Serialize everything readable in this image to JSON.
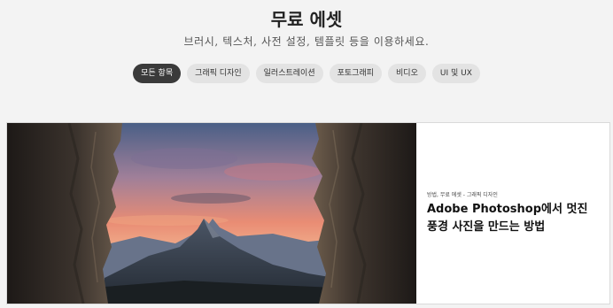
{
  "header": {
    "title": "무료 에셋",
    "subtitle": "브러시, 텍스처, 사전 설정, 템플릿 등을 이용하세요."
  },
  "filters": [
    {
      "label": "모든 항목",
      "active": true
    },
    {
      "label": "그래픽 디자인",
      "active": false
    },
    {
      "label": "일러스트레이션",
      "active": false
    },
    {
      "label": "포토그래피",
      "active": false
    },
    {
      "label": "비디오",
      "active": false
    },
    {
      "label": "UI 및 UX",
      "active": false
    }
  ],
  "featured": {
    "meta": "방법, 무료 에셋 - 그래픽 디자인",
    "headline_line1": "Adobe Photoshop에서 멋진",
    "headline_line2": "풍경 사진을 만드는 방법",
    "image_description": "mountain-sunset-through-canyon"
  }
}
